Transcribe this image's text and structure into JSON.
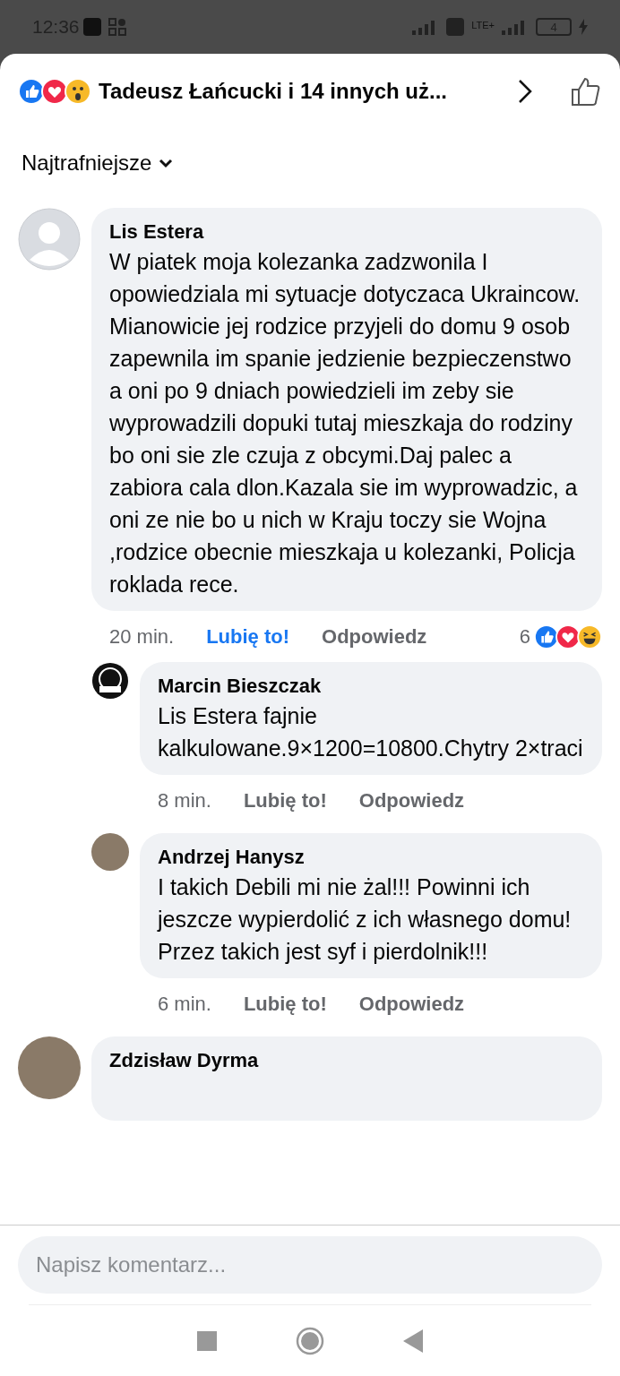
{
  "status_bar": {
    "time": "12:36",
    "battery": "4",
    "network": "LTE+"
  },
  "header": {
    "title": "Tadeusz Łańcucki i 14 innych uż..."
  },
  "sort": {
    "label": "Najtrafniejsze"
  },
  "comments": [
    {
      "author": "Lis Estera",
      "text": "W piatek moja kolezanka zadzwonila I opowiedziala mi sytuacje dotyczaca Ukraincow. Mianowicie jej rodzice przyjeli do domu 9 osob zapewnila im spanie jedzienie bezpieczenstwo a oni po 9 dniach powiedzieli im zeby sie wyprowadzili dopuki tutaj mieszkaja do rodziny bo oni sie zle czuja z obcymi.Daj palec a zabiora cala dlon.Kazala sie im wyprowadzic, a oni ze nie bo u nich w Kraju toczy sie Wojna ,rodzice obecnie mieszkaja u kolezanki, Policja roklada rece.",
      "time": "20 min.",
      "like": "Lubię to!",
      "liked": true,
      "reply": "Odpowiedz",
      "reaction_count": "6",
      "kind": "silhouette",
      "replies": [
        {
          "author": "Marcin Bieszczak",
          "text": "Lis Estera fajnie kalkulowane.9×1200=10800.Chytry 2×traci",
          "time": "8 min.",
          "like": "Lubię to!",
          "liked": false,
          "reply": "Odpowiedz",
          "kind": "logo"
        },
        {
          "author": "Andrzej Hanysz",
          "text": "I takich Debili mi nie żal!!! Powinni ich jeszcze wypierdolić z ich własnego domu! Przez takich jest syf i pierdolnik!!!",
          "time": "6 min.",
          "like": "Lubię to!",
          "liked": false,
          "reply": "Odpowiedz",
          "kind": "photo"
        }
      ]
    },
    {
      "author": "Zdzisław Dyrma",
      "kind": "photo"
    }
  ],
  "composer": {
    "placeholder": "Napisz komentarz..."
  }
}
